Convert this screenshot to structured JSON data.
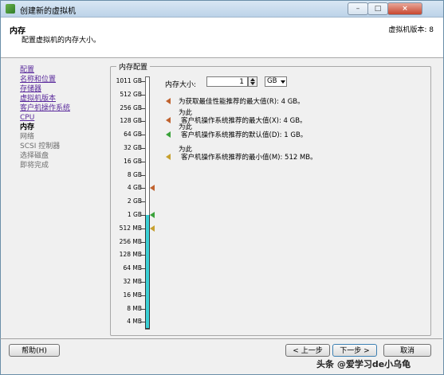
{
  "window": {
    "title": "创建新的虚拟机",
    "controls": {
      "minimize": "–",
      "maximize": "□",
      "close": "×"
    }
  },
  "header": {
    "title": "内存",
    "subtitle": "配置虚拟机的内存大小。",
    "vm_version": "虚拟机版本: 8"
  },
  "nav": {
    "items": [
      {
        "label": "配置",
        "state": "done"
      },
      {
        "label": "名称和位置",
        "state": "done"
      },
      {
        "label": "存储器",
        "state": "done"
      },
      {
        "label": "虚拟机版本",
        "state": "done"
      },
      {
        "label": "客户机操作系统",
        "state": "done"
      },
      {
        "label": "CPU",
        "state": "done"
      },
      {
        "label": "内存",
        "state": "current"
      },
      {
        "label": "网络",
        "state": "future"
      },
      {
        "label": "SCSI 控制器",
        "state": "future"
      },
      {
        "label": "选择磁盘",
        "state": "future"
      },
      {
        "label": "即将完成",
        "state": "future"
      }
    ]
  },
  "memory": {
    "group_title": "内存配置",
    "size_label": "内存大小:",
    "value": "1",
    "unit": "GB",
    "scale_labels": [
      "1011 GB",
      "512 GB",
      "256 GB",
      "128 GB",
      "64 GB",
      "32 GB",
      "16 GB",
      "8 GB",
      "4 GB",
      "2 GB",
      "1 GB",
      "512 MB",
      "256 MB",
      "128 MB",
      "64 MB",
      "32 MB",
      "16 MB",
      "8 MB",
      "4 MB"
    ],
    "selected_level_index": 10,
    "markers": [
      {
        "level_index": 8,
        "color": "#c0622e"
      },
      {
        "level_index": 10,
        "color": "#3aa23a"
      },
      {
        "level_index": 11,
        "color": "#c7a02e"
      }
    ],
    "legend": [
      {
        "line1": "",
        "line2": "为获取最佳性能推荐的最大值(R): 4 GB。",
        "color": "#c0622e"
      },
      {
        "line1": "为此",
        "line2": "客户机操作系统推荐的最大值(X): 4 GB。",
        "color": "#c0622e"
      },
      {
        "line1": "为此",
        "line2": "客户机操作系统推荐的默认值(D): 1 GB。",
        "color": "#3aa23a"
      },
      {
        "line1": "为此",
        "line2": "客户机操作系统推荐的最小值(M): 512 MB。",
        "color": "#c7a02e"
      }
    ]
  },
  "footer": {
    "help": "帮助(H)",
    "back": "< 上一步",
    "next": "下一步 >",
    "cancel": "取消"
  },
  "watermark": "头条 @爱学习de小乌龟"
}
